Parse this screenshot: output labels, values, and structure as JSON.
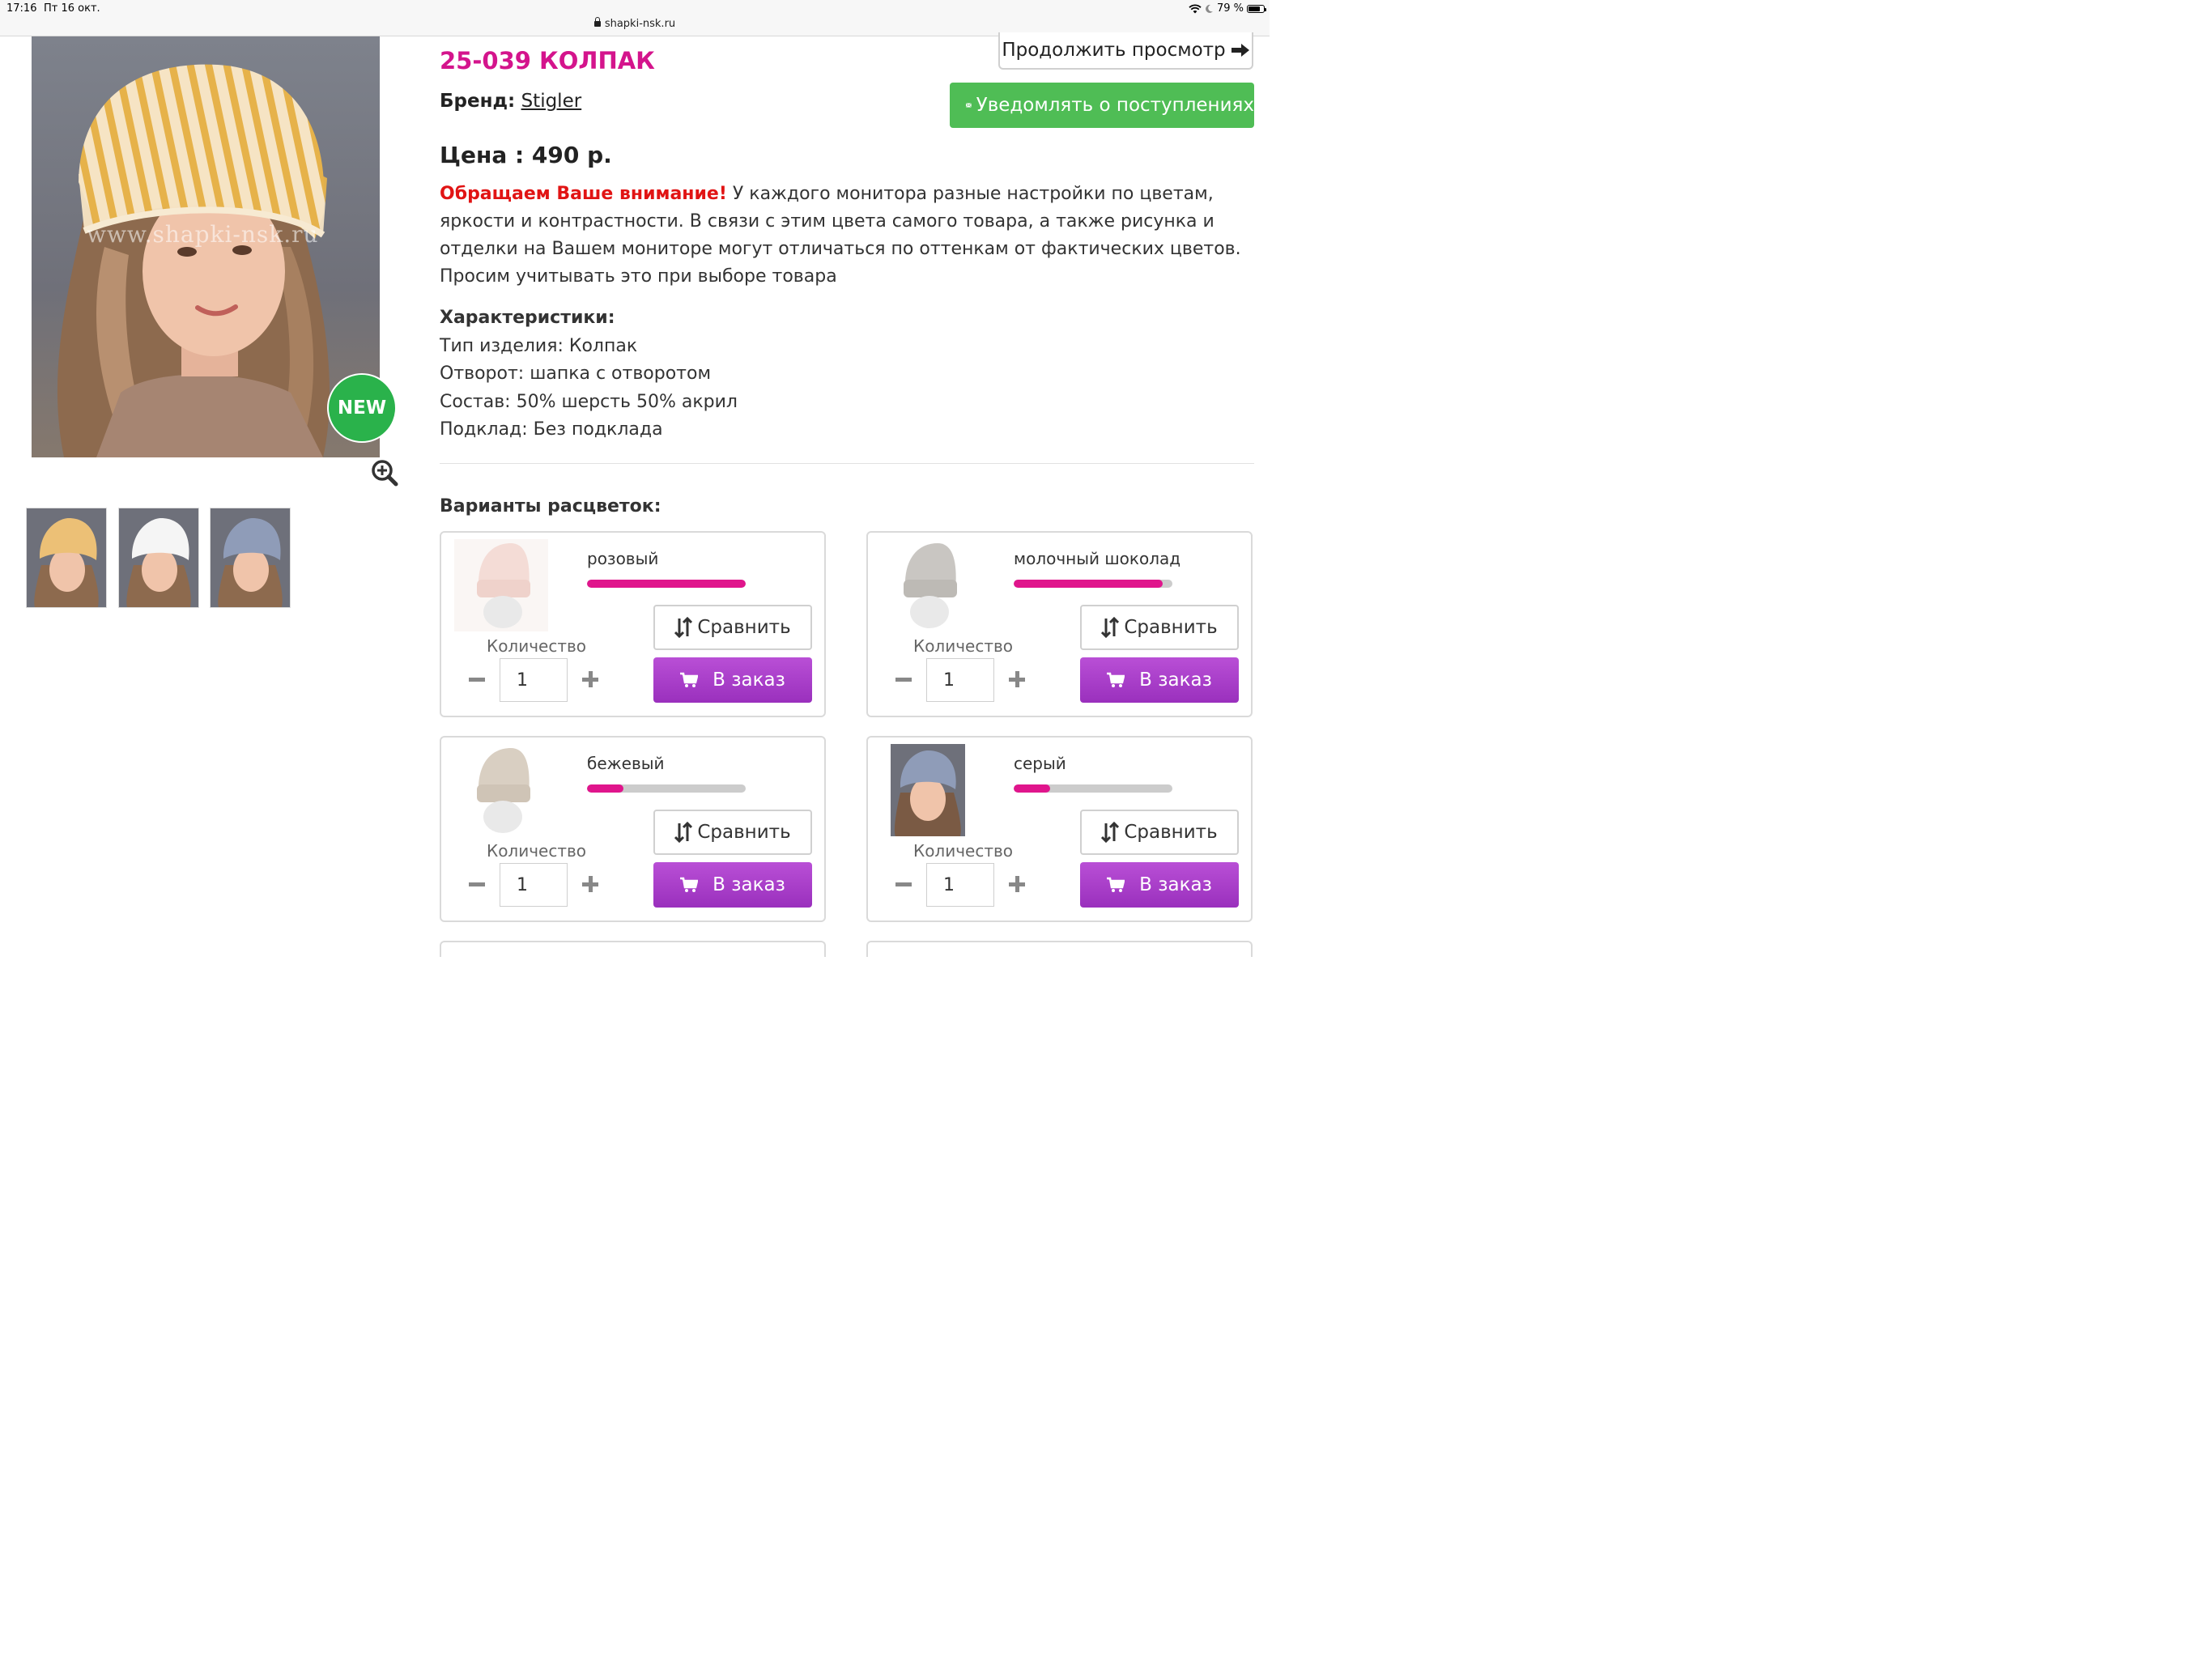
{
  "status_bar": {
    "time": "17:16",
    "date": "Пт 16 окт.",
    "url": "shapki-nsk.ru",
    "battery": "79 %"
  },
  "product": {
    "title": "25-039 КОЛПАК",
    "brand_label": "Бренд:",
    "brand_name": "Stigler",
    "price": "Цена : 490 р.",
    "badge": "NEW",
    "watermark": "www.shapki-nsk.ru"
  },
  "buttons": {
    "continue": "Продолжить просмотр",
    "notify": "Уведомлять о поступлениях"
  },
  "notice": {
    "warning": "Обращаем Ваше внимание!",
    "text": " У каждого монитора разные настройки по цветам, яркости и контрастности. В связи с этим цвета самого товара, а также рисунка и отделки на Вашем мониторе могут отличаться по оттенкам от фактических цветов. Просим учитывать это при выборе товара"
  },
  "specs": {
    "heading": "Характеристики:",
    "rows": [
      "Тип изделия: Колпак",
      "Отворот: шапка с отворотом",
      "Состав: 50% шерсть 50% акрил",
      "Подклад: Без подклада"
    ]
  },
  "variants": {
    "title": "Варианты расцветок:",
    "items": [
      {
        "name": "розовый",
        "level": 1.0,
        "qty_label": "Количество",
        "qty": "1",
        "compare": "Сравнить",
        "order": "В заказ"
      },
      {
        "name": "молочный шоколад",
        "level": 0.94,
        "qty_label": "Количество",
        "qty": "1",
        "compare": "Сравнить",
        "order": "В заказ"
      },
      {
        "name": "бежевый",
        "level": 0.23,
        "qty_label": "Количество",
        "qty": "1",
        "compare": "Сравнить",
        "order": "В заказ"
      },
      {
        "name": "серый",
        "level": 0.23,
        "qty_label": "Количество",
        "qty": "1",
        "compare": "Сравнить",
        "order": "В заказ"
      }
    ]
  },
  "colors": {
    "accent": "#d4148c",
    "warning": "#e11414",
    "notify_green": "#4fbd55",
    "order_purple": "#a53cc8",
    "badge_green": "#2ab24b"
  },
  "icons": [
    "lock-icon",
    "wifi-icon",
    "moon-icon",
    "battery-icon",
    "arrow-right-icon",
    "envelope-icon",
    "zoom-in-icon",
    "sort-arrows-icon",
    "cart-icon",
    "minus-icon",
    "plus-icon"
  ]
}
